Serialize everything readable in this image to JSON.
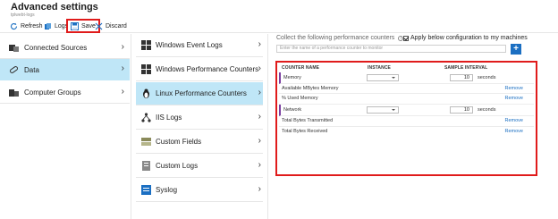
{
  "header": {
    "title": "Advanced settings",
    "subtitle": "tplwebt-logs"
  },
  "toolbar": {
    "refresh_label": "Refresh",
    "logs_label": "Logs",
    "save_label": "Save",
    "discard_label": "Discard"
  },
  "sidebar": {
    "items": [
      {
        "label": "Connected Sources",
        "icon": "sources-icon"
      },
      {
        "label": "Data",
        "icon": "data-icon",
        "selected": true
      },
      {
        "label": "Computer Groups",
        "icon": "computer-groups-icon"
      }
    ]
  },
  "datasources": {
    "items": [
      {
        "label": "Windows Event Logs",
        "icon": "windows-icon"
      },
      {
        "label": "Windows Performance Counters",
        "icon": "windows-icon"
      },
      {
        "label": "Linux Performance Counters",
        "icon": "linux-icon",
        "selected": true
      },
      {
        "label": "IIS Logs",
        "icon": "iis-icon"
      },
      {
        "label": "Custom Fields",
        "icon": "custom-fields-icon"
      },
      {
        "label": "Custom Logs",
        "icon": "custom-logs-icon"
      },
      {
        "label": "Syslog",
        "icon": "syslog-icon"
      }
    ]
  },
  "main": {
    "header_text": "Collect the following performance counters",
    "apply_label": "Apply below configuration to my machines",
    "add_placeholder": "Enter the name of a performance counter to monitor",
    "add_button": "+",
    "columns": {
      "name": "COUNTER NAME",
      "instance": "INSTANCE",
      "interval": "SAMPLE INTERVAL"
    },
    "rows": [
      {
        "name": "Memory",
        "group": true,
        "instance": "",
        "interval": "10",
        "unit": "seconds"
      },
      {
        "name": "Available MBytes Memory",
        "remove": "Remove"
      },
      {
        "name": "% Used Memory",
        "remove": "Remove"
      },
      {
        "name": "Network",
        "group": true,
        "instance": "",
        "interval": "10",
        "unit": "seconds"
      },
      {
        "name": "Total Bytes Transmitted",
        "remove": "Remove"
      },
      {
        "name": "Total Bytes Received",
        "remove": "Remove"
      }
    ]
  },
  "colors": {
    "accent": "#1b6fc2",
    "selected": "#bfe6f7",
    "highlight_border": "#e01b1b",
    "group_marker": "#7a3fa0"
  }
}
